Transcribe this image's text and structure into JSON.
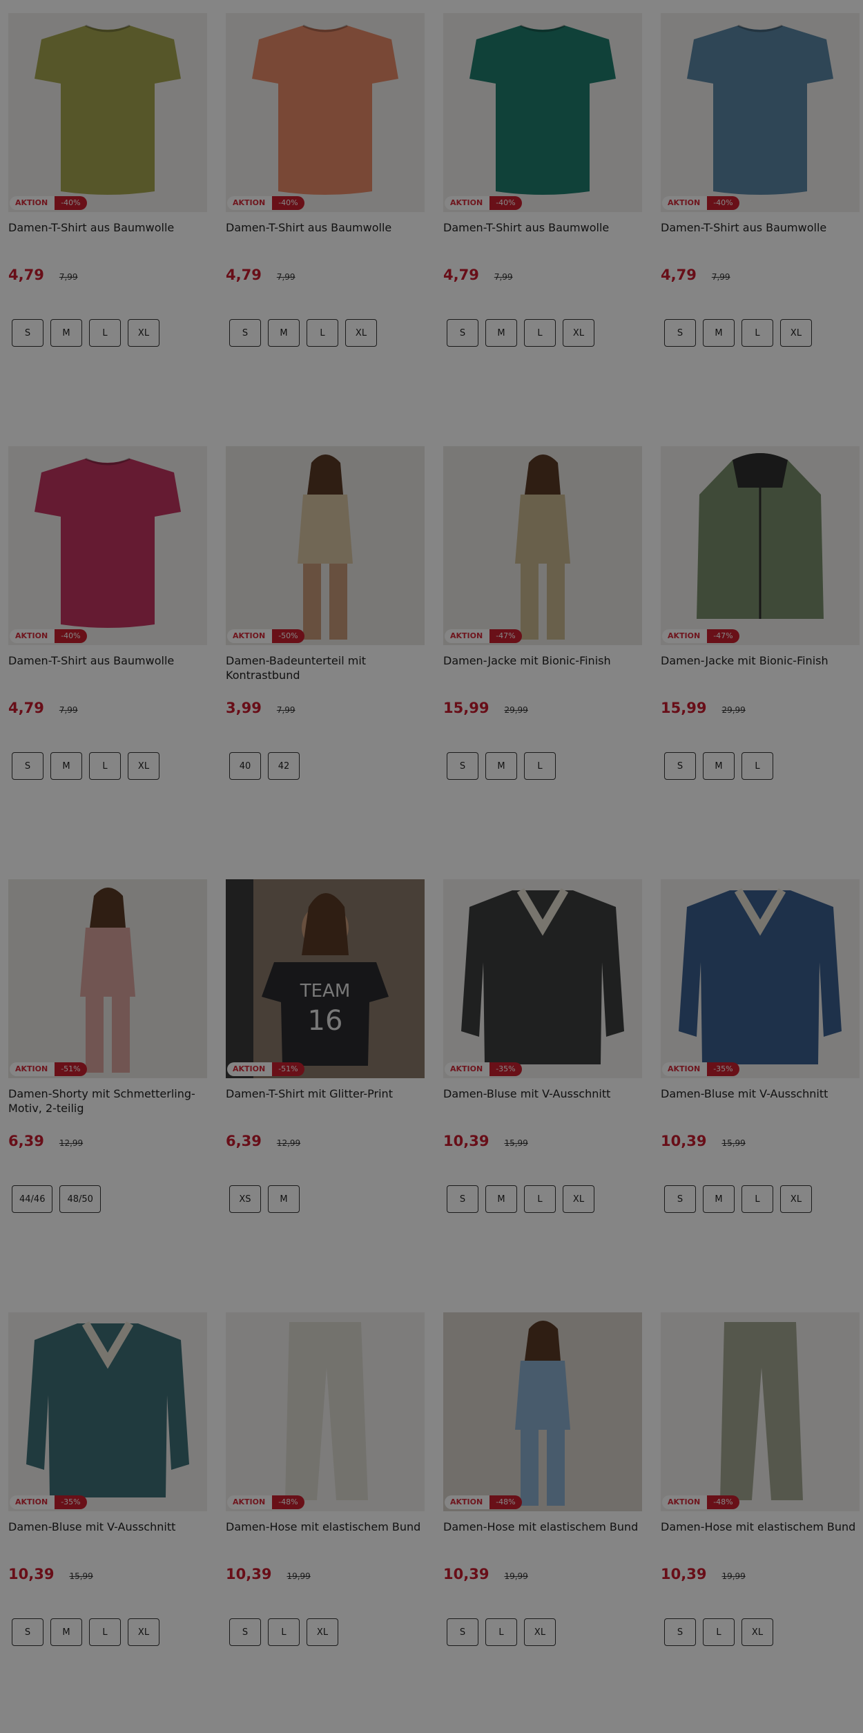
{
  "badge_label": "AKTION",
  "products": [
    {
      "name": "Damen-T-Shirt aus Baumwolle",
      "discount": "-40%",
      "price": "4,79",
      "old_price": "7,99",
      "sizes": [
        "S",
        "M",
        "L",
        "XL"
      ],
      "color": "#a6a650",
      "kind": "tshirt"
    },
    {
      "name": "Damen-T-Shirt aus Baumwolle",
      "discount": "-40%",
      "price": "4,79",
      "old_price": "7,99",
      "sizes": [
        "S",
        "M",
        "L",
        "XL"
      ],
      "color": "#e98a68",
      "kind": "tshirt"
    },
    {
      "name": "Damen-T-Shirt aus Baumwolle",
      "discount": "-40%",
      "price": "4,79",
      "old_price": "7,99",
      "sizes": [
        "S",
        "M",
        "L",
        "XL"
      ],
      "color": "#1f7d6e",
      "kind": "tshirt"
    },
    {
      "name": "Damen-T-Shirt aus Baumwolle",
      "discount": "-40%",
      "price": "4,79",
      "old_price": "7,99",
      "sizes": [
        "S",
        "M",
        "L",
        "XL"
      ],
      "color": "#5b87a6",
      "kind": "tshirt"
    },
    {
      "name": "Damen-T-Shirt aus Baumwolle",
      "discount": "-40%",
      "price": "4,79",
      "old_price": "7,99",
      "sizes": [
        "S",
        "M",
        "L",
        "XL"
      ],
      "color": "#c23460",
      "kind": "tshirt"
    },
    {
      "name": "Damen-Badeunterteil mit Kontrastbund",
      "discount": "-50%",
      "price": "3,99",
      "old_price": "7,99",
      "sizes": [
        "40",
        "42"
      ],
      "color": "#d9c6a4",
      "kind": "swim"
    },
    {
      "name": "Damen-Jacke mit Bionic-Finish",
      "discount": "-47%",
      "price": "15,99",
      "old_price": "29,99",
      "sizes": [
        "S",
        "M",
        "L"
      ],
      "color": "#c9b890",
      "kind": "jacketmodel"
    },
    {
      "name": "Damen-Jacke mit Bionic-Finish",
      "discount": "-47%",
      "price": "15,99",
      "old_price": "29,99",
      "sizes": [
        "S",
        "M",
        "L"
      ],
      "color": "#7a8f6b",
      "kind": "jacket"
    },
    {
      "name": "Damen-Shorty mit Schmetterling-Motiv, 2-teilig",
      "discount": "-51%",
      "price": "6,39",
      "old_price": "12,99",
      "sizes": [
        "44/46",
        "48/50"
      ],
      "color": "#d9a49e",
      "kind": "model"
    },
    {
      "name": "Damen-T-Shirt mit Glitter-Print",
      "discount": "-51%",
      "price": "6,39",
      "old_price": "12,99",
      "sizes": [
        "XS",
        "M"
      ],
      "color": "#2b2b2e",
      "kind": "teamshirt"
    },
    {
      "name": "Damen-Bluse mit V-Ausschnitt",
      "discount": "-35%",
      "price": "10,39",
      "old_price": "15,99",
      "sizes": [
        "S",
        "M",
        "L",
        "XL"
      ],
      "color": "#3c3f3e",
      "kind": "blouse"
    },
    {
      "name": "Damen-Bluse mit V-Ausschnitt",
      "discount": "-35%",
      "price": "10,39",
      "old_price": "15,99",
      "sizes": [
        "S",
        "M",
        "L",
        "XL"
      ],
      "color": "#3b5f8e",
      "kind": "blouse"
    },
    {
      "name": "Damen-Bluse mit V-Ausschnitt",
      "discount": "-35%",
      "price": "10,39",
      "old_price": "15,99",
      "sizes": [
        "S",
        "M",
        "L",
        "XL"
      ],
      "color": "#3e6f78",
      "kind": "blouse"
    },
    {
      "name": "Damen-Hose mit elastischem Bund",
      "discount": "-48%",
      "price": "10,39",
      "old_price": "19,99",
      "sizes": [
        "S",
        "L",
        "XL"
      ],
      "color": "#dcdbd2",
      "kind": "pants"
    },
    {
      "name": "Damen-Hose mit elastischem Bund",
      "discount": "-48%",
      "price": "10,39",
      "old_price": "19,99",
      "sizes": [
        "S",
        "L",
        "XL"
      ],
      "color": "#8aaed0",
      "kind": "pantsmodel"
    },
    {
      "name": "Damen-Hose mit elastischem Bund",
      "discount": "-48%",
      "price": "10,39",
      "old_price": "19,99",
      "sizes": [
        "S",
        "L",
        "XL"
      ],
      "color": "#a4a893",
      "kind": "pants"
    }
  ]
}
